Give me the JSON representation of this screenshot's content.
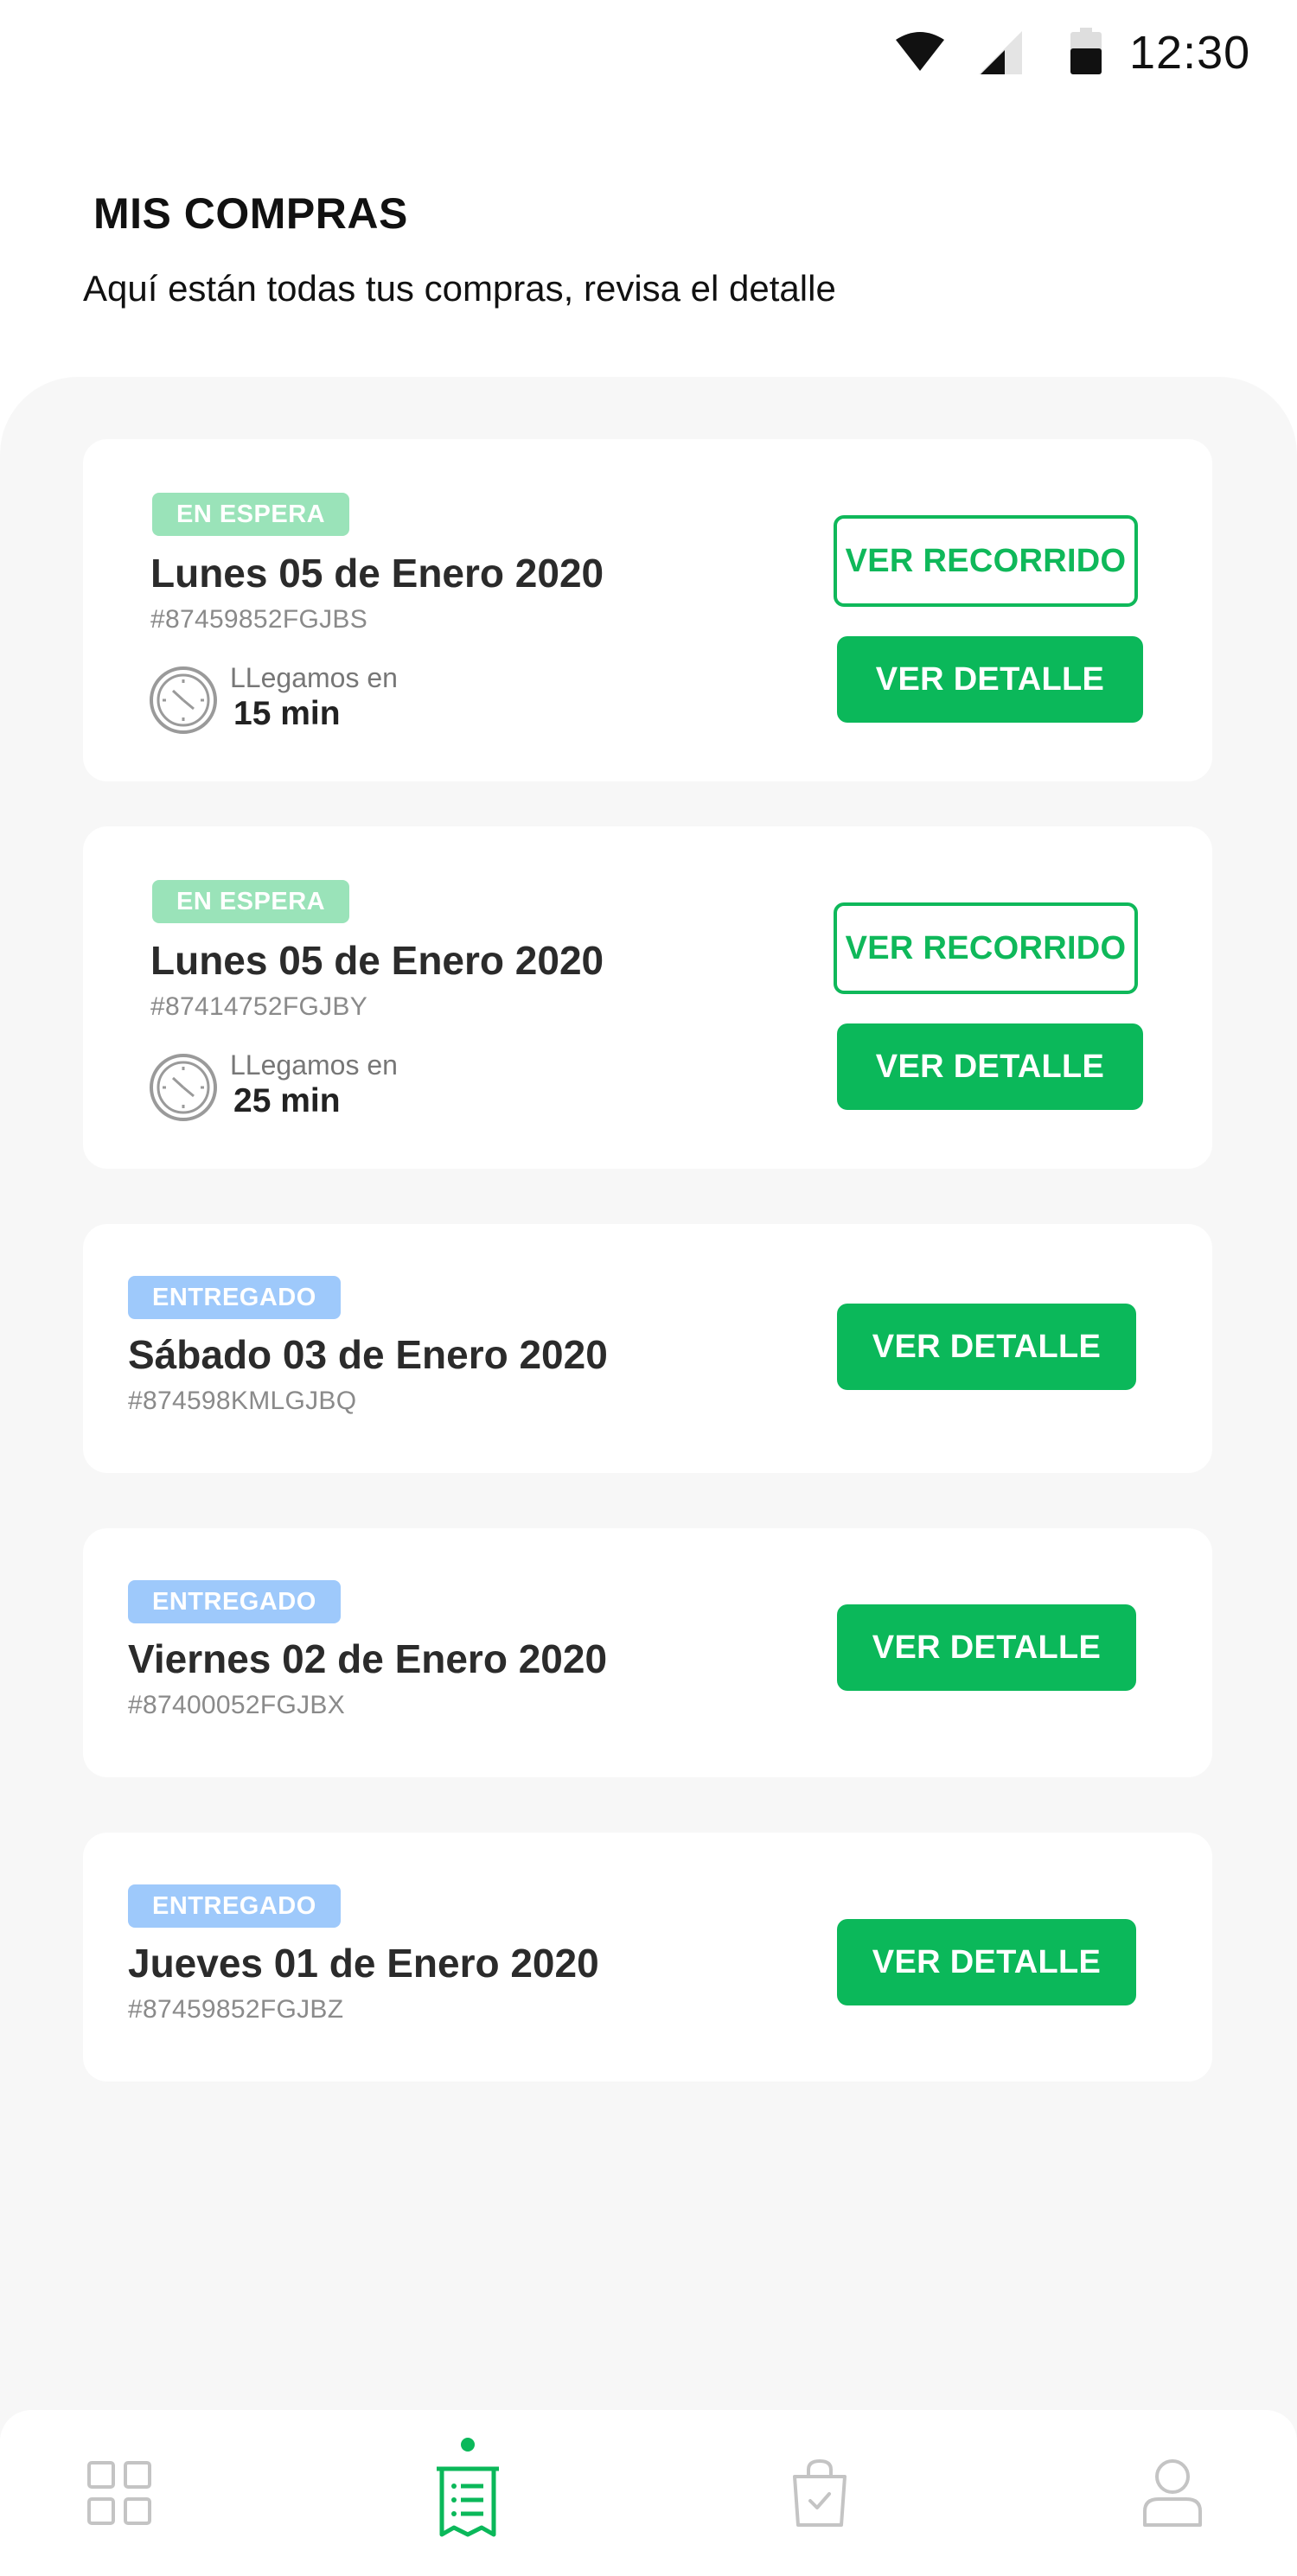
{
  "status_bar": {
    "time": "12:30",
    "icons": [
      "wifi-icon",
      "signal-icon",
      "battery-icon"
    ]
  },
  "header": {
    "title": "MIS COMPRAS",
    "subtitle": "Aquí están todas tus compras, revisa el detalle"
  },
  "orders": [
    {
      "status": "EN ESPERA",
      "date": "Lunes 05 de Enero 2020",
      "id": "#87459852FGJBS",
      "eta_label": "LLegamos en",
      "eta_value": "15 min",
      "track_label": "VER RECORRIDO",
      "detail_label": "VER DETALLE"
    },
    {
      "status": "EN ESPERA",
      "date": "Lunes 05 de Enero 2020",
      "id": "#87414752FGJBY",
      "eta_label": "LLegamos en",
      "eta_value": "25 min",
      "track_label": "VER RECORRIDO",
      "detail_label": "VER DETALLE"
    },
    {
      "status": "ENTREGADO",
      "date": "Sábado 03 de Enero 2020",
      "id": "#874598KMLGJBQ",
      "detail_label": "VER DETALLE"
    },
    {
      "status": "ENTREGADO",
      "date": "Viernes 02 de Enero 2020",
      "id": "#87400052FGJBX",
      "detail_label": "VER DETALLE"
    },
    {
      "status": "ENTREGADO",
      "date": "Jueves 01 de Enero 2020",
      "id": "#87459852FGJBZ",
      "detail_label": "VER DETALLE"
    }
  ],
  "nav": {
    "items": [
      "grid-icon",
      "receipt-list-icon",
      "shopping-bag-icon",
      "user-icon"
    ],
    "active": "receipt-list-icon"
  },
  "colors": {
    "accent": "#0bb85a",
    "badge_wait": "#9ae3b9",
    "badge_done": "#9ec9fb",
    "panel_bg": "#f7f7f7"
  }
}
